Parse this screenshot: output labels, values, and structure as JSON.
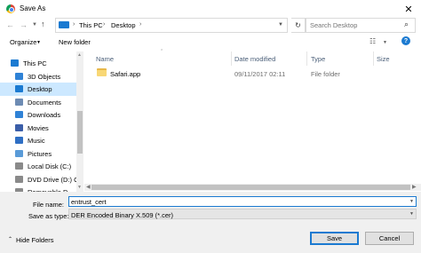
{
  "window": {
    "title": "Save As",
    "close_glyph": "✕",
    "app_icon": "chrome-icon"
  },
  "address": {
    "crumbs": [
      "This PC",
      "Desktop"
    ],
    "separator": "›",
    "refresh_glyph": "↻"
  },
  "search": {
    "placeholder": "Search Desktop"
  },
  "toolbar": {
    "organize_label": "Organize",
    "new_folder_label": "New folder",
    "help_glyph": "?"
  },
  "nav_pane": {
    "items": [
      {
        "label": "This PC",
        "icon": "pc-icon",
        "color": "#1b7ad1"
      },
      {
        "label": "3D Objects",
        "icon": "cube-icon",
        "color": "#2f82d6"
      },
      {
        "label": "Desktop",
        "icon": "desktop-icon",
        "color": "#1b7ad1",
        "selected": true
      },
      {
        "label": "Documents",
        "icon": "documents-icon",
        "color": "#6d8bb3"
      },
      {
        "label": "Downloads",
        "icon": "download-icon",
        "color": "#2f82d6"
      },
      {
        "label": "Movies",
        "icon": "movies-icon",
        "color": "#3b5ea8"
      },
      {
        "label": "Music",
        "icon": "music-icon",
        "color": "#2f6fc4"
      },
      {
        "label": "Pictures",
        "icon": "pictures-icon",
        "color": "#5a9bd8"
      },
      {
        "label": "Local Disk (C:)",
        "icon": "disk-icon",
        "color": "#8a8a8a"
      },
      {
        "label": "DVD Drive (D:) C",
        "icon": "dvd-icon",
        "color": "#8a8a8a"
      },
      {
        "label": "Removable D",
        "icon": "usb-icon",
        "color": "#8a8a8a"
      }
    ]
  },
  "file_list": {
    "columns": [
      "Name",
      "Date modified",
      "Type",
      "Size"
    ],
    "rows": [
      {
        "name": "Safari.app",
        "date": "09/11/2017 02:11",
        "type": "File folder",
        "size": ""
      }
    ]
  },
  "form": {
    "filename_label": "File name:",
    "filename_value": "entrust_cert",
    "savetype_label": "Save as type:",
    "savetype_value": "DER Encoded Binary X.509 (*.cer)"
  },
  "footer": {
    "hide_folders_label": "Hide Folders",
    "save_label": "Save",
    "cancel_label": "Cancel"
  },
  "colors": {
    "accent": "#1b7ad1",
    "selection": "#cce8ff",
    "folder": "#f8d775"
  }
}
